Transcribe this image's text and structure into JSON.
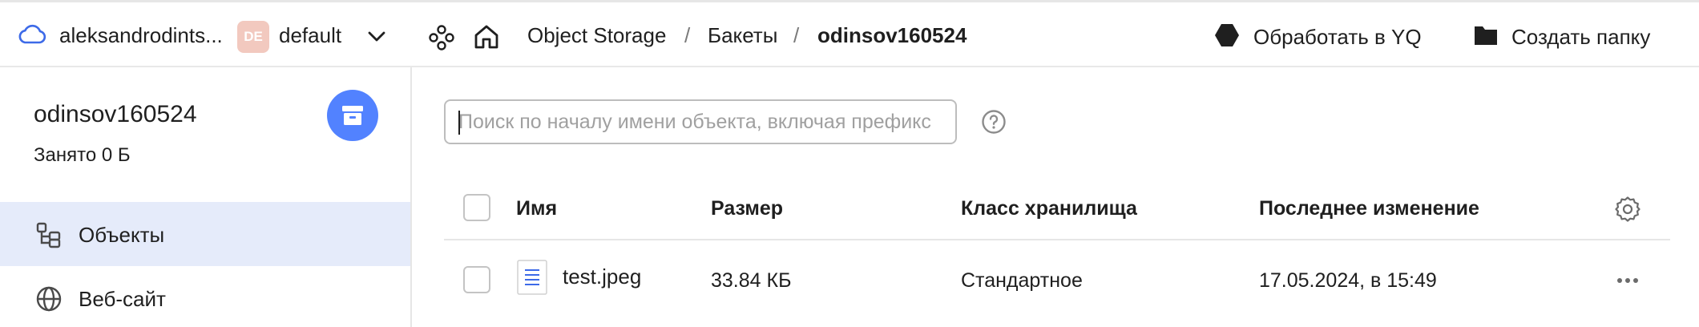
{
  "topbar": {
    "account": "aleksandrodints...",
    "folder_badge": "DE",
    "folder": "default",
    "breadcrumbs": [
      "Object Storage",
      "Бакеты",
      "odinsov160524"
    ],
    "separator": "/",
    "actions": {
      "yq": "Обработать в YQ",
      "create_folder": "Создать папку"
    }
  },
  "sidebar": {
    "bucket_name": "odinsov160524",
    "usage": "Занято 0 Б",
    "nav": [
      {
        "label": "Объекты",
        "icon": "objects-tree-icon",
        "active": true
      },
      {
        "label": "Веб-сайт",
        "icon": "globe-icon",
        "active": false
      }
    ]
  },
  "search": {
    "placeholder": "Поиск по началу имени объекта, включая префикс",
    "value": ""
  },
  "table": {
    "columns": [
      "Имя",
      "Размер",
      "Класс хранилища",
      "Последнее изменение"
    ],
    "rows": [
      {
        "name": "test.jpeg",
        "size": "33.84 КБ",
        "storage_class": "Стандартное",
        "modified": "17.05.2024, в 15:49"
      }
    ]
  },
  "colors": {
    "accent": "#5282ff",
    "active_nav_bg": "#e5ebfa",
    "folder_badge_bg": "#f2c9bf"
  }
}
